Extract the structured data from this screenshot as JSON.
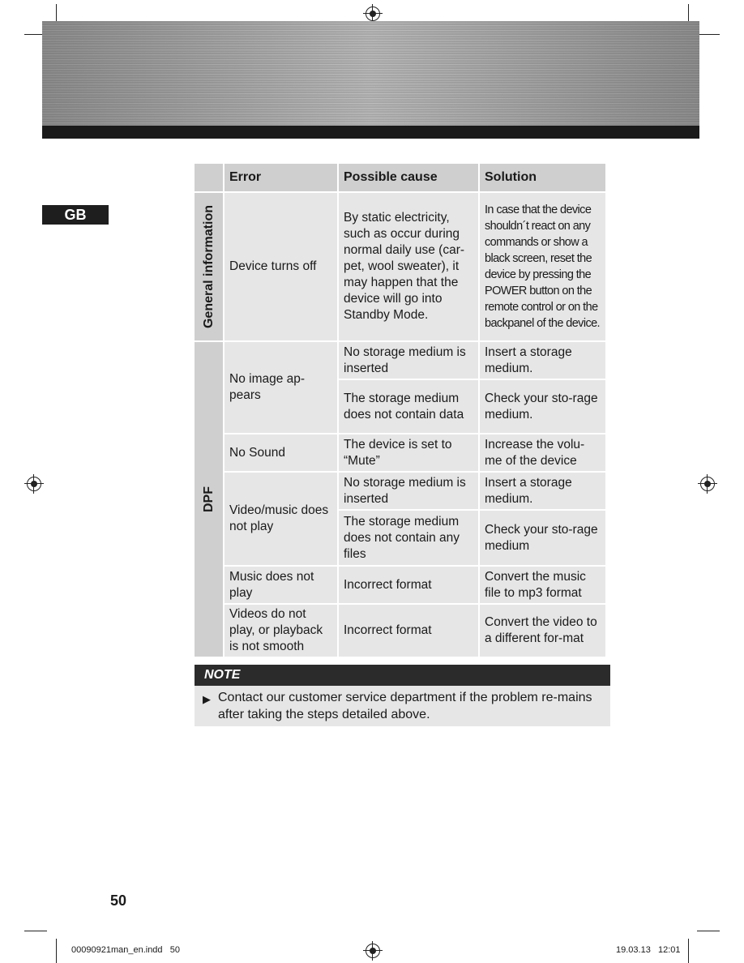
{
  "language_tab": "GB",
  "table": {
    "headers": [
      "",
      "Error",
      "Possible cause",
      "Solution"
    ],
    "sections": [
      {
        "label": "General information",
        "rows": [
          {
            "error": "Device turns off",
            "cause": "By static electricity, such as occur during normal daily use (car-pet, wool sweater), it may happen that the device will go into Standby Mode.",
            "solution": "In case that the device shouldn´t react on any commands or show a black screen, reset the device by pressing the POWER button on the remote control or on the backpanel of the device."
          }
        ]
      },
      {
        "label": "DPF",
        "rows": [
          {
            "error": "No image ap-pears",
            "cause": "No storage medium is inserted",
            "solution": "Insert a storage medium."
          },
          {
            "cause": "The storage medium does not contain data",
            "solution": "Check your sto-rage medium."
          },
          {
            "error": "No Sound",
            "cause": "The device is set to “Mute”",
            "solution": "Increase the volu-me of the device"
          },
          {
            "error": "Video/music does not play",
            "cause": "No storage medium is inserted",
            "solution": "Insert a storage medium."
          },
          {
            "cause": "The storage medium does not contain any files",
            "solution": "Check your sto-rage medium"
          },
          {
            "error": "Music does not play",
            "cause": "Incorrect format",
            "solution": "Convert the music file to mp3 format"
          },
          {
            "error": "Videos do not play, or playback is not smooth",
            "cause": "Incorrect format",
            "solution": "Convert the video to a different for-mat"
          }
        ]
      }
    ]
  },
  "note": {
    "title": "NOTE",
    "icon": "arrow-right-icon",
    "text": "Contact our customer service department if the problem re-mains after taking the steps detailed above."
  },
  "page_number": "50",
  "footer": {
    "file": "00090921man_en.indd   50",
    "datetime": "19.03.13   12:01"
  }
}
